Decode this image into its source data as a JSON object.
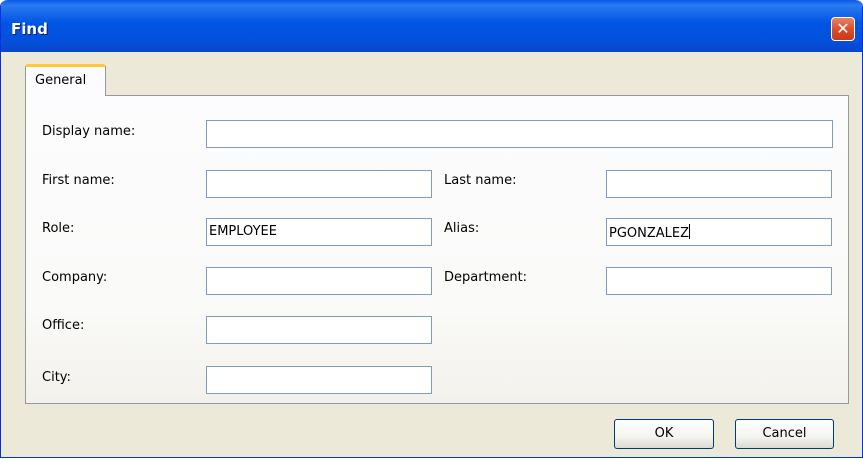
{
  "window": {
    "title": "Find"
  },
  "tabs": [
    {
      "label": "General",
      "active": true
    }
  ],
  "fields": {
    "display_name": {
      "label": "Display name:",
      "value": ""
    },
    "first_name": {
      "label": "First name:",
      "value": ""
    },
    "last_name": {
      "label": "Last name:",
      "value": ""
    },
    "role": {
      "label": "Role:",
      "value": "EMPLOYEE"
    },
    "alias": {
      "label": "Alias:",
      "value": "PGONZALEZ"
    },
    "company": {
      "label": "Company:",
      "value": ""
    },
    "department": {
      "label": "Department:",
      "value": ""
    },
    "office": {
      "label": "Office:",
      "value": ""
    },
    "city": {
      "label": "City:",
      "value": ""
    }
  },
  "buttons": {
    "ok": "OK",
    "cancel": "Cancel"
  },
  "icons": {
    "close": "close-icon"
  },
  "colors": {
    "titlebar": "#0054e3",
    "tab_accent": "#ffc83c",
    "field_border": "#7f9db9",
    "window_bg": "#ece9d8"
  }
}
